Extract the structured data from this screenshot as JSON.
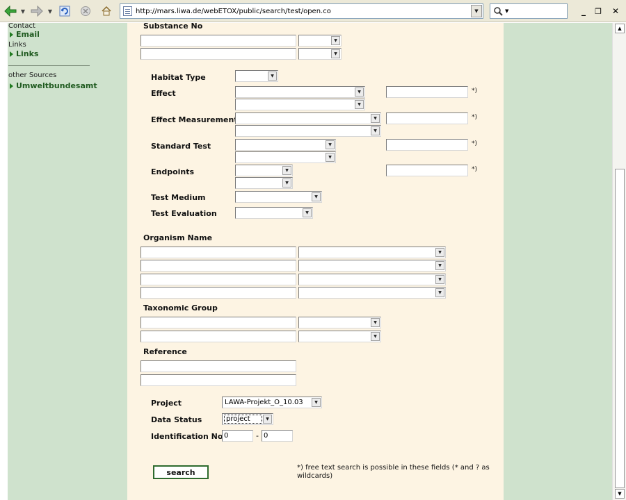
{
  "browser": {
    "url": "http://mars.liwa.de/webETOX/public/search/test/open.co",
    "back_icon": "back-arrow-icon",
    "forward_icon": "forward-arrow-icon",
    "refresh_icon": "refresh-icon",
    "stop_icon": "stop-icon",
    "home_icon": "home-icon",
    "search_icon": "magnifier-icon",
    "minimize": "_",
    "restore": "❐",
    "close": "✕"
  },
  "sidebar": {
    "contact_heading": "Contact",
    "email_link": "Email",
    "links_heading": "Links",
    "links_link": "Links",
    "other_sources_heading": "other Sources",
    "uba_link": "Umweltbundesamt"
  },
  "form": {
    "substance_no_label": "Substance No",
    "habitat_type_label": "Habitat Type",
    "effect_label": "Effect",
    "effect_measurement_label": "Effect Measurement",
    "standard_test_label": "Standard Test",
    "endpoints_label": "Endpoints",
    "test_medium_label": "Test Medium",
    "test_evaluation_label": "Test Evaluation",
    "free_text_marker": "*)",
    "organism_name_label": "Organism Name",
    "taxonomic_group_label": "Taxonomic Group",
    "reference_label": "Reference",
    "project_label": "Project",
    "project_value": "LAWA-Projekt_O_10.03",
    "data_status_label": "Data Status",
    "data_status_value": "project",
    "identification_no_label": "Identification No",
    "id_from": "0",
    "id_separator": "-",
    "id_to": "0",
    "search_button": "search",
    "footnote": "*) free text search is possible in these fields (* and ? as wildcards)"
  },
  "colors": {
    "sidebar_bg": "#cfe2cd",
    "content_bg": "#fdf4e3",
    "link_green": "#1f5a1f"
  }
}
